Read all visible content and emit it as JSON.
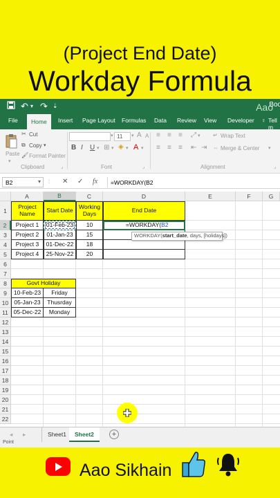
{
  "title_line1": "(Project End Date)",
  "title_line2": "Workday Formula",
  "brand_name": "Aao Sikhain",
  "colors": {
    "background": "#f7f200",
    "excel_green": "#217346",
    "header_yellow": "#ffff00"
  },
  "excel": {
    "logo_partial": "Aao",
    "window_text_partial": "Boo",
    "ribbon_tabs": [
      "File",
      "Home",
      "Insert",
      "Page Layout",
      "Formulas",
      "Data",
      "Review",
      "View",
      "Developer"
    ],
    "tell_me": "Tell m",
    "clipboard": {
      "paste": "Paste",
      "cut": "Cut",
      "copy": "Copy",
      "format_painter": "Format Painter",
      "group_label": "Clipboard"
    },
    "font": {
      "size": "11",
      "group_label": "Font"
    },
    "alignment": {
      "wrap_text": "Wrap Text",
      "merge_center": "Merge & Center",
      "group_label": "Alignment"
    },
    "name_box": "B2",
    "formula_bar": "=WORKDAY(B2",
    "formula_tooltip": {
      "fn": "WORKDAY(",
      "arg1": "start_date",
      "rest": ", days, [holidays])"
    },
    "columns": [
      "A",
      "B",
      "C",
      "D",
      "E",
      "F",
      "G"
    ],
    "rows": [
      "1",
      "2",
      "3",
      "4",
      "5",
      "6",
      "7",
      "8",
      "9",
      "10",
      "11",
      "12",
      "13",
      "14",
      "15",
      "16",
      "17",
      "18",
      "19",
      "20",
      "21",
      "22"
    ],
    "table": {
      "headers": [
        "Project Name",
        "Start Date",
        "Working Days",
        "End Date"
      ],
      "rows": [
        [
          "Project 1",
          "01-Feb-23",
          "10",
          "=WORKDAY(B2"
        ],
        [
          "Project 2",
          "01-Jan-23",
          "15",
          ""
        ],
        [
          "Project 3",
          "01-Dec-22",
          "18",
          ""
        ],
        [
          "Project 4",
          "25-Nov-22",
          "20",
          ""
        ]
      ]
    },
    "holiday_table": {
      "header": "Govt Holiday",
      "rows": [
        [
          "10-Feb-23",
          "Friday"
        ],
        [
          "05-Jan-23",
          "Thusrday"
        ],
        [
          "05-Dec-22",
          "Monday"
        ]
      ]
    },
    "sheets": [
      "Sheet1",
      "Sheet2"
    ],
    "active_sheet": "Sheet2",
    "status": "Point"
  }
}
